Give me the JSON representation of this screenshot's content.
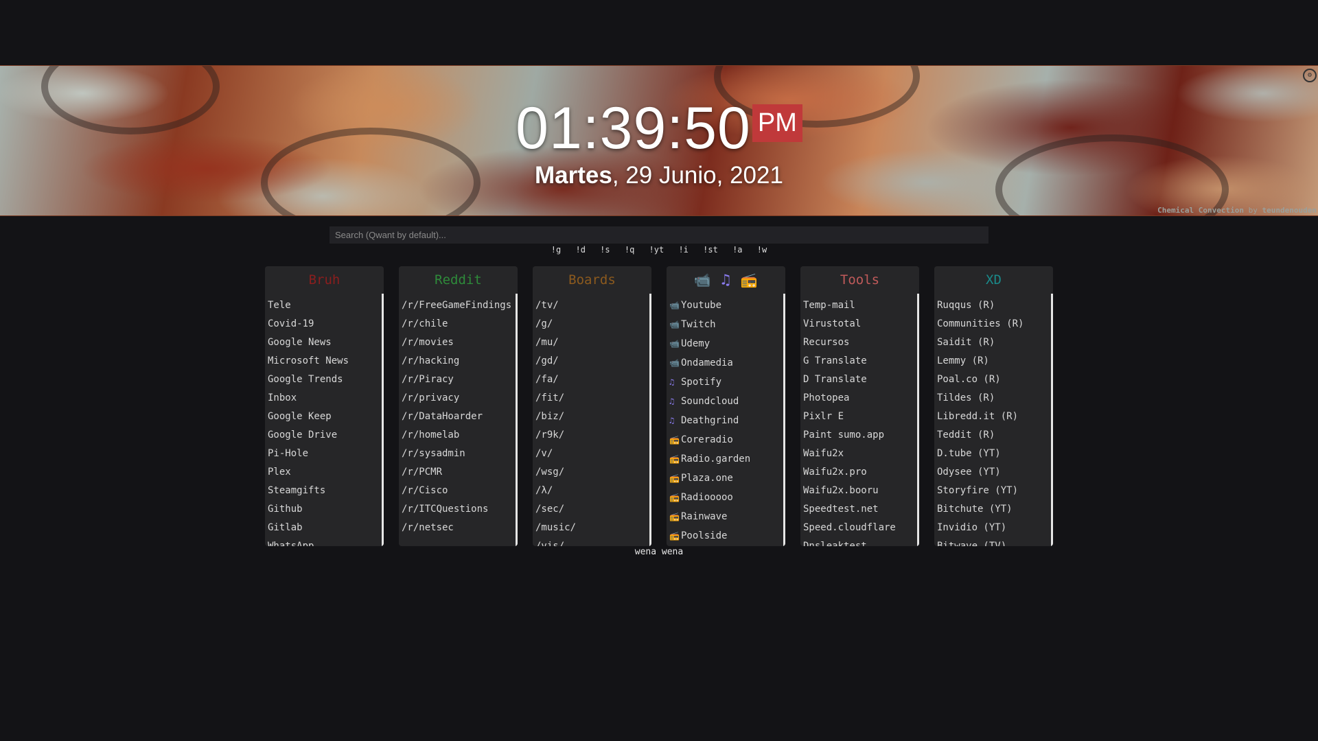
{
  "clock": {
    "time": "01:39:50",
    "ampm": "PM"
  },
  "date": {
    "weekday": "Martes",
    "rest": ", 29 Junio, 2021"
  },
  "credit": {
    "title": "Chemical Convection",
    "by": " by ",
    "author": "teundenouden"
  },
  "search": {
    "placeholder": "Search (Qwant by default)..."
  },
  "bangs": [
    "!g",
    "!d",
    "!s",
    "!q",
    "!yt",
    "!i",
    "!st",
    "!a",
    "!w"
  ],
  "colors": {
    "bruh": "#8b1e1e",
    "reddit": "#2e8b3a",
    "boards": "#8c5a1e",
    "tools": "#c05a5a",
    "xd": "#1a8a8a",
    "ampm_bg": "#c0393a",
    "music_icon": "#8b7cf0"
  },
  "columns": {
    "bruh": {
      "title": "Bruh",
      "items": [
        "Tele",
        "Covid-19",
        "Google News",
        "Microsoft News",
        "Google Trends",
        "Inbox",
        "Google Keep",
        "Google Drive",
        "Pi-Hole",
        "Plex",
        "Steamgifts",
        "Github",
        "Gitlab",
        "WhatsApp"
      ]
    },
    "reddit": {
      "title": "Reddit",
      "items": [
        "/r/FreeGameFindings",
        "/r/chile",
        "/r/movies",
        "/r/hacking",
        "/r/Piracy",
        "/r/privacy",
        "/r/DataHoarder",
        "/r/homelab",
        "/r/sysadmin",
        "/r/PCMR",
        "/r/Cisco",
        "/r/ITCQuestions",
        "/r/netsec"
      ]
    },
    "boards": {
      "title": "Boards",
      "items": [
        "/tv/",
        "/g/",
        "/mu/",
        "/gd/",
        "/fa/",
        "/fit/",
        "/biz/",
        "/r9k/",
        "/v/",
        "/wsg/",
        "/λ/",
        "/sec/",
        "/music/",
        "/vis/"
      ]
    },
    "media": {
      "header_icons": [
        "video-camera-icon",
        "music-note-icon",
        "radio-icon"
      ],
      "items": [
        {
          "icon": "video",
          "label": "Youtube"
        },
        {
          "icon": "video",
          "label": "Twitch"
        },
        {
          "icon": "video",
          "label": "Udemy"
        },
        {
          "icon": "video",
          "label": "Ondamedia"
        },
        {
          "icon": "music",
          "label": "Spotify"
        },
        {
          "icon": "music",
          "label": "Soundcloud"
        },
        {
          "icon": "music",
          "label": "Deathgrind"
        },
        {
          "icon": "radio",
          "label": "Coreradio"
        },
        {
          "icon": "radio",
          "label": "Radio.garden"
        },
        {
          "icon": "radio",
          "label": "Plaza.one"
        },
        {
          "icon": "radio",
          "label": "Radiooooo"
        },
        {
          "icon": "radio",
          "label": "Rainwave"
        },
        {
          "icon": "radio",
          "label": "Poolside"
        }
      ]
    },
    "tools": {
      "title": "Tools",
      "items": [
        "Temp-mail",
        "Virustotal",
        "Recursos",
        "G Translate",
        "D Translate",
        "Photopea",
        "Pixlr E",
        "Paint sumo.app",
        "Waifu2x",
        "Waifu2x.pro",
        "Waifu2x.booru",
        "Speedtest.net",
        "Speed.cloudflare",
        "Dnsleaktest"
      ]
    },
    "xd": {
      "title": "XD",
      "items": [
        "Ruqqus (R)",
        "Communities (R)",
        "Saidit (R)",
        "Lemmy (R)",
        "Poal.co (R)",
        "Tildes (R)",
        "Libredd.it (R)",
        "Teddit (R)",
        "D.tube (YT)",
        "Odysee (YT)",
        "Storyfire (YT)",
        "Bitchute (YT)",
        "Invidio (YT)",
        "Bitwave (TV)"
      ]
    }
  },
  "footer": {
    "text": "wena wena"
  }
}
